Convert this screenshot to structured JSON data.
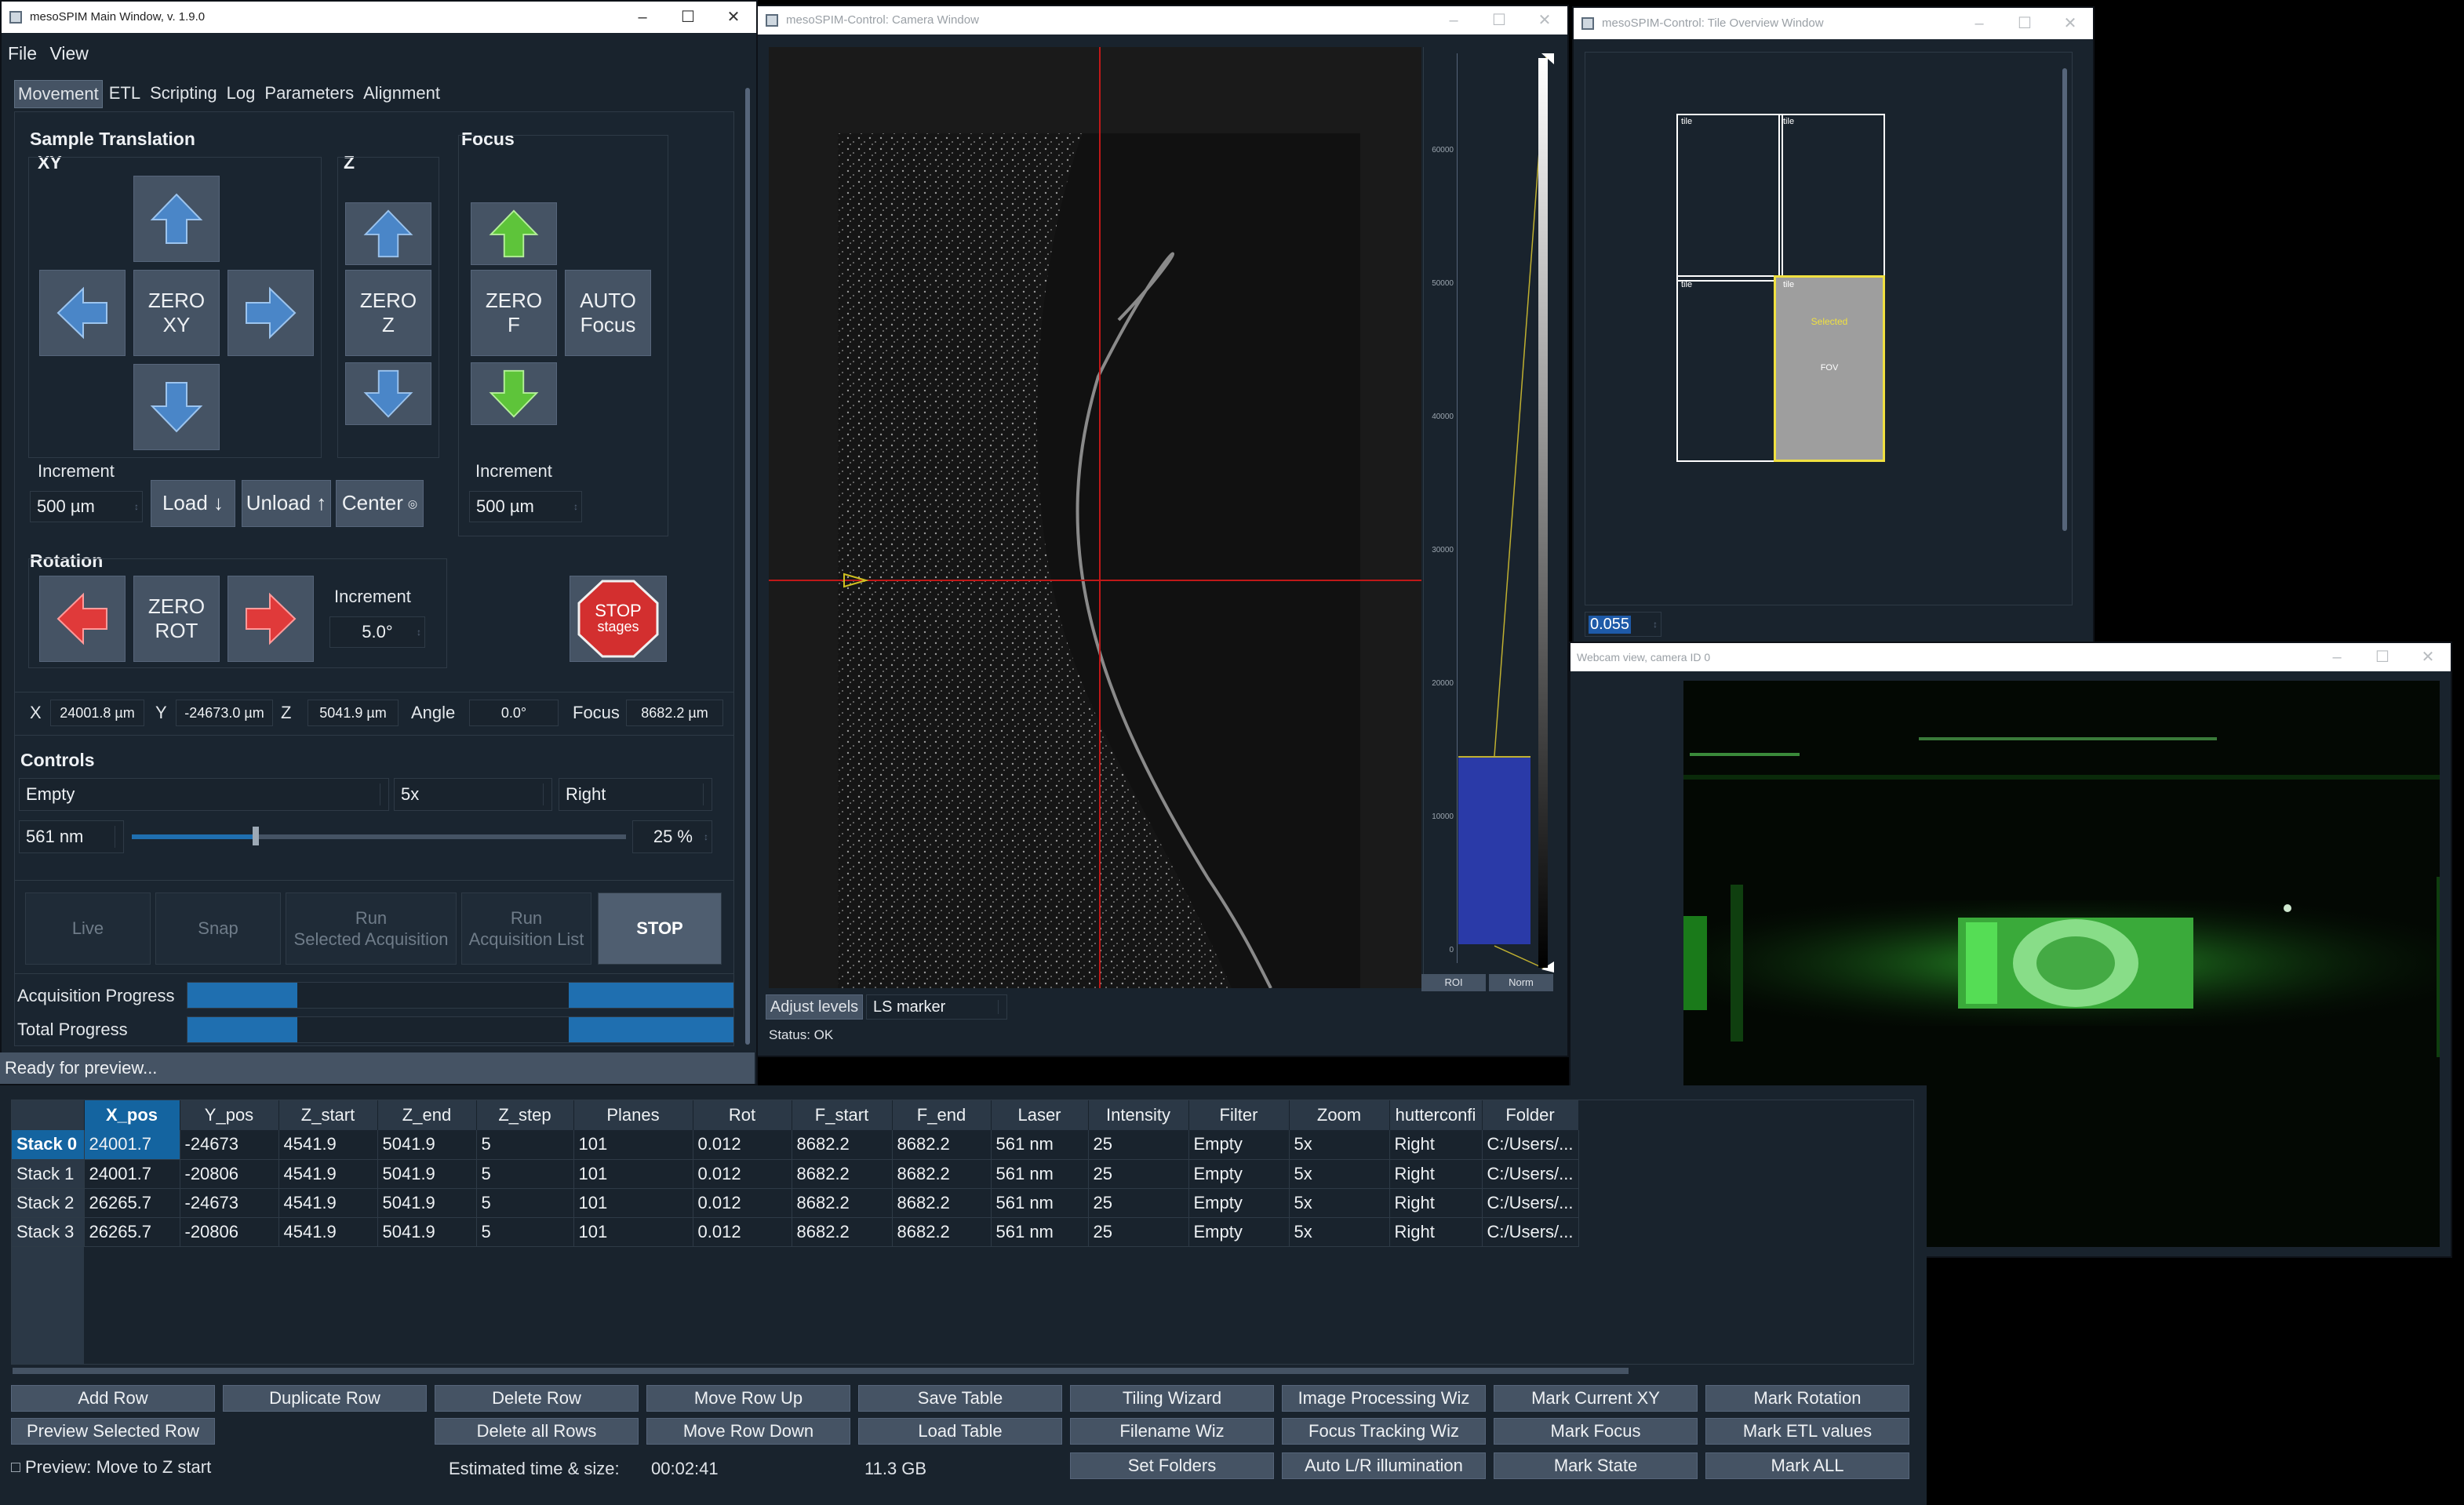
{
  "main_window": {
    "title": "mesoSPIM Main Window, v. 1.9.0",
    "menu": [
      "File",
      "View"
    ],
    "tabs": [
      "Movement",
      "ETL",
      "Scripting",
      "Log",
      "Parameters",
      "Alignment"
    ],
    "sample_translation": {
      "title": "Sample Translation",
      "xy_label": "XY",
      "z_label": "Z",
      "zero_xy": [
        "ZERO",
        "XY"
      ],
      "zero_z": [
        "ZERO",
        "Z"
      ],
      "increment_label": "Increment",
      "increment_value": "500 µm",
      "load": "Load ↓",
      "unload": "Unload ↑",
      "center": "Center"
    },
    "focus": {
      "title": "Focus",
      "zero_f": [
        "ZERO",
        "F"
      ],
      "auto_focus": [
        "AUTO",
        "Focus"
      ],
      "increment_label": "Increment",
      "increment_value": "500 µm"
    },
    "rotation": {
      "title": "Rotation",
      "zero_rot": [
        "ZERO",
        "ROT"
      ],
      "increment_label": "Increment",
      "increment_value": "5.0°",
      "stop_stages": [
        "STOP",
        "stages"
      ]
    },
    "position": {
      "x_label": "X",
      "x": "24001.8 µm",
      "y_label": "Y",
      "y": "-24673.0 µm",
      "z_label": "Z",
      "z": "5041.9 µm",
      "angle_label": "Angle",
      "angle": "0.0°",
      "focus_label": "Focus",
      "focus": "8682.2 µm"
    },
    "controls": {
      "title": "Controls",
      "filter": "Empty",
      "zoom": "5x",
      "shutter": "Right",
      "laser": "561 nm",
      "intensity_fraction": 0.25,
      "intensity": "25 %"
    },
    "actions": {
      "live": "Live",
      "snap": "Snap",
      "run_selected": [
        "Run",
        "Selected Acquisition"
      ],
      "run_list": [
        "Run",
        "Acquisition List"
      ],
      "stop": "STOP"
    },
    "acquisition_progress_label": "Acquisition Progress",
    "total_progress_label": "Total Progress",
    "status": "Ready for preview..."
  },
  "table": {
    "columns": [
      "X_pos",
      "Y_pos",
      "Z_start",
      "Z_end",
      "Z_step",
      "Planes",
      "Rot",
      "F_start",
      "F_end",
      "Laser",
      "Intensity",
      "Filter",
      "Zoom",
      "hutterconfi",
      "Folder"
    ],
    "rows": [
      {
        "header": "Stack 0",
        "cells": [
          "24001.7",
          "-24673",
          "4541.9",
          "5041.9",
          "5",
          "101",
          "0.012",
          "8682.2",
          "8682.2",
          "561 nm",
          "25",
          "Empty",
          "5x",
          "Right",
          "C:/Users/..."
        ]
      },
      {
        "header": "Stack 1",
        "cells": [
          "24001.7",
          "-20806",
          "4541.9",
          "5041.9",
          "5",
          "101",
          "0.012",
          "8682.2",
          "8682.2",
          "561 nm",
          "25",
          "Empty",
          "5x",
          "Right",
          "C:/Users/..."
        ]
      },
      {
        "header": "Stack 2",
        "cells": [
          "26265.7",
          "-24673",
          "4541.9",
          "5041.9",
          "5",
          "101",
          "0.012",
          "8682.2",
          "8682.2",
          "561 nm",
          "25",
          "Empty",
          "5x",
          "Right",
          "C:/Users/..."
        ]
      },
      {
        "header": "Stack 3",
        "cells": [
          "26265.7",
          "-20806",
          "4541.9",
          "5041.9",
          "5",
          "101",
          "0.012",
          "8682.2",
          "8682.2",
          "561 nm",
          "25",
          "Empty",
          "5x",
          "Right",
          "C:/Users/..."
        ]
      }
    ]
  },
  "toolbar": {
    "row1": [
      "Add Row",
      "Duplicate Row",
      "Delete Row",
      "Move Row Up",
      "Save Table",
      "Tiling Wizard",
      "Image Processing Wiz",
      "Mark Current XY",
      "Mark Rotation"
    ],
    "row2": [
      "Preview Selected Row",
      "Delete all Rows",
      "Move Row Down",
      "Load Table",
      "Filename Wiz",
      "Focus Tracking Wiz",
      "Mark Focus",
      "Mark ETL values"
    ],
    "row3": [
      "Set Folders",
      "Auto L/R illumination",
      "Mark State",
      "Mark ALL"
    ],
    "preview_checkbox": "Preview: Move to Z start",
    "estimated_label": "Estimated time & size:",
    "estimated_time": "00:02:41",
    "estimated_size": "11.3 GB"
  },
  "camera_window": {
    "title": "mesoSPIM-Control: Camera Window",
    "histogram_ticks": [
      "60000",
      "50000",
      "40000",
      "30000",
      "20000",
      "10000",
      "0"
    ],
    "roi": "ROI",
    "norm": "Norm",
    "adjust_levels": "Adjust levels",
    "ls_marker": "LS marker",
    "status": "Status: OK"
  },
  "tile_window": {
    "title": "mesoSPIM-Control: Tile Overview Window",
    "tile_label": "tile",
    "selected_label": "Selected",
    "fov_label": "FOV",
    "value": "0.055"
  },
  "webcam_window": {
    "title": "Webcam view, camera ID 0"
  },
  "colors": {
    "bg": "#19232d",
    "button": "#455364",
    "accent_blue": "#1464a0",
    "progress": "#1f6fb0",
    "arrow_blue": "#4a86c8",
    "arrow_green": "#5ec43a",
    "arrow_red": "#e03a3a",
    "stop_red": "#d32f2f",
    "tile_yellow": "#f0e040"
  }
}
